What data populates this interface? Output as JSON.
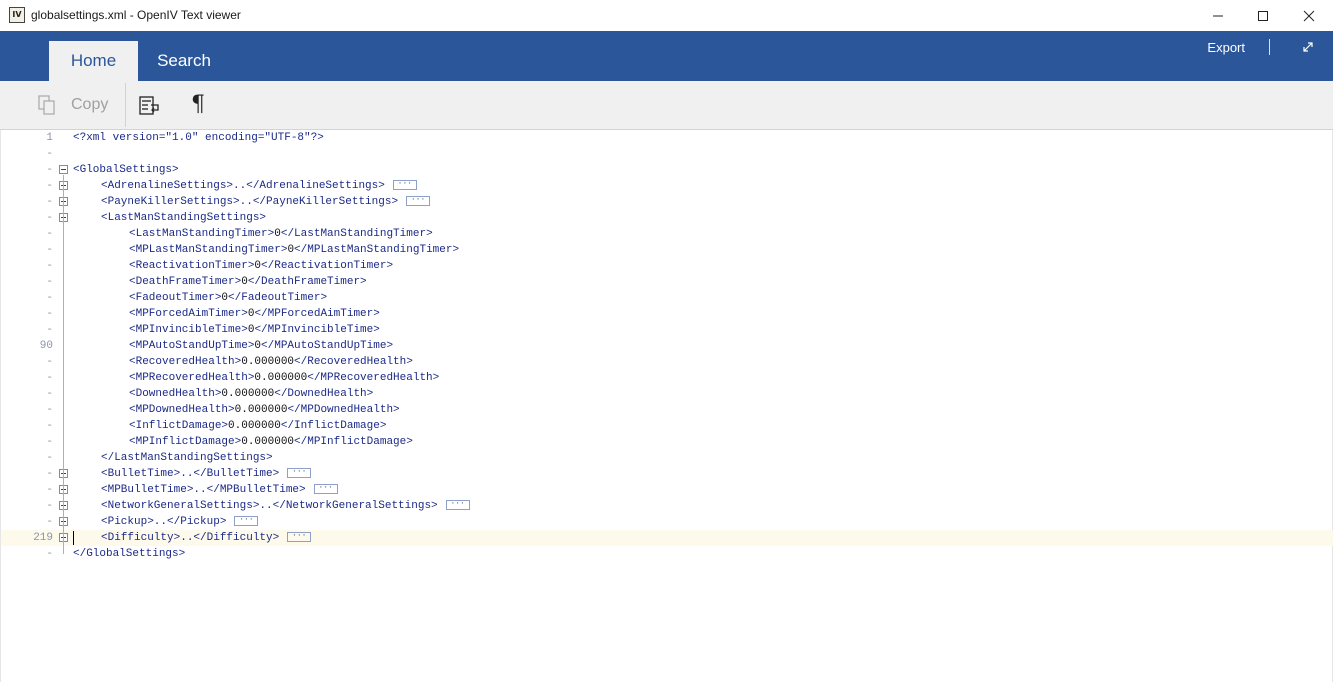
{
  "window": {
    "title": "globalsettings.xml - OpenIV Text viewer",
    "app_icon_text": "IV"
  },
  "ribbon": {
    "tabs": [
      "Home",
      "Search"
    ],
    "active_tab": "Home",
    "export_label": "Export"
  },
  "toolbar": {
    "copy_label": "Copy",
    "pilcrow": "¶"
  },
  "editor": {
    "collapsed_marker": "···",
    "lines": [
      {
        "num": "1",
        "indent": 0,
        "fold": "",
        "segs": [
          {
            "t": "<?xml version=\"1.0\" encoding=\"UTF-8\"?>",
            "c": "decl"
          }
        ]
      },
      {
        "num": "-",
        "indent": 0,
        "fold": "",
        "segs": []
      },
      {
        "num": "-",
        "indent": 0,
        "fold": "minus",
        "segs": [
          {
            "t": "<GlobalSettings>",
            "c": "tag"
          }
        ]
      },
      {
        "num": "-",
        "indent": 1,
        "fold": "plus",
        "segs": [
          {
            "t": "<AdrenalineSettings>..</AdrenalineSettings>",
            "c": "tag"
          }
        ],
        "more": true
      },
      {
        "num": "-",
        "indent": 1,
        "fold": "plus",
        "segs": [
          {
            "t": "<PayneKillerSettings>..</PayneKillerSettings>",
            "c": "tag"
          }
        ],
        "more": true
      },
      {
        "num": "-",
        "indent": 1,
        "fold": "minus",
        "segs": [
          {
            "t": "<LastManStandingSettings>",
            "c": "tag"
          }
        ]
      },
      {
        "num": "-",
        "indent": 2,
        "fold": "",
        "segs": [
          {
            "t": "<LastManStandingTimer>",
            "c": "tag"
          },
          {
            "t": "0",
            "c": "val"
          },
          {
            "t": "</LastManStandingTimer>",
            "c": "tag"
          }
        ]
      },
      {
        "num": "-",
        "indent": 2,
        "fold": "",
        "segs": [
          {
            "t": "<MPLastManStandingTimer>",
            "c": "tag"
          },
          {
            "t": "0",
            "c": "val"
          },
          {
            "t": "</MPLastManStandingTimer>",
            "c": "tag"
          }
        ]
      },
      {
        "num": "-",
        "indent": 2,
        "fold": "",
        "segs": [
          {
            "t": "<ReactivationTimer>",
            "c": "tag"
          },
          {
            "t": "0",
            "c": "val"
          },
          {
            "t": "</ReactivationTimer>",
            "c": "tag"
          }
        ]
      },
      {
        "num": "-",
        "indent": 2,
        "fold": "",
        "segs": [
          {
            "t": "<DeathFrameTimer>",
            "c": "tag"
          },
          {
            "t": "0",
            "c": "val"
          },
          {
            "t": "</DeathFrameTimer>",
            "c": "tag"
          }
        ]
      },
      {
        "num": "-",
        "indent": 2,
        "fold": "",
        "segs": [
          {
            "t": "<FadeoutTimer>",
            "c": "tag"
          },
          {
            "t": "0",
            "c": "val"
          },
          {
            "t": "</FadeoutTimer>",
            "c": "tag"
          }
        ]
      },
      {
        "num": "-",
        "indent": 2,
        "fold": "",
        "segs": [
          {
            "t": "<MPForcedAimTimer>",
            "c": "tag"
          },
          {
            "t": "0",
            "c": "val"
          },
          {
            "t": "</MPForcedAimTimer>",
            "c": "tag"
          }
        ]
      },
      {
        "num": "-",
        "indent": 2,
        "fold": "",
        "segs": [
          {
            "t": "<MPInvincibleTime>",
            "c": "tag"
          },
          {
            "t": "0",
            "c": "val"
          },
          {
            "t": "</MPInvincibleTime>",
            "c": "tag"
          }
        ]
      },
      {
        "num": "90",
        "indent": 2,
        "fold": "",
        "segs": [
          {
            "t": "<MPAutoStandUpTime>",
            "c": "tag"
          },
          {
            "t": "0",
            "c": "val"
          },
          {
            "t": "</MPAutoStandUpTime>",
            "c": "tag"
          }
        ]
      },
      {
        "num": "-",
        "indent": 2,
        "fold": "",
        "segs": [
          {
            "t": "<RecoveredHealth>",
            "c": "tag"
          },
          {
            "t": "0.000000",
            "c": "val"
          },
          {
            "t": "</RecoveredHealth>",
            "c": "tag"
          }
        ]
      },
      {
        "num": "-",
        "indent": 2,
        "fold": "",
        "segs": [
          {
            "t": "<MPRecoveredHealth>",
            "c": "tag"
          },
          {
            "t": "0.000000",
            "c": "val"
          },
          {
            "t": "</MPRecoveredHealth>",
            "c": "tag"
          }
        ]
      },
      {
        "num": "-",
        "indent": 2,
        "fold": "",
        "segs": [
          {
            "t": "<DownedHealth>",
            "c": "tag"
          },
          {
            "t": "0.000000",
            "c": "val"
          },
          {
            "t": "</DownedHealth>",
            "c": "tag"
          }
        ]
      },
      {
        "num": "-",
        "indent": 2,
        "fold": "",
        "segs": [
          {
            "t": "<MPDownedHealth>",
            "c": "tag"
          },
          {
            "t": "0.000000",
            "c": "val"
          },
          {
            "t": "</MPDownedHealth>",
            "c": "tag"
          }
        ]
      },
      {
        "num": "-",
        "indent": 2,
        "fold": "",
        "segs": [
          {
            "t": "<InflictDamage>",
            "c": "tag"
          },
          {
            "t": "0.000000",
            "c": "val"
          },
          {
            "t": "</InflictDamage>",
            "c": "tag"
          }
        ]
      },
      {
        "num": "-",
        "indent": 2,
        "fold": "",
        "segs": [
          {
            "t": "<MPInflictDamage>",
            "c": "tag"
          },
          {
            "t": "0.000000",
            "c": "val"
          },
          {
            "t": "</MPInflictDamage>",
            "c": "tag"
          }
        ]
      },
      {
        "num": "-",
        "indent": 1,
        "fold": "",
        "segs": [
          {
            "t": "</LastManStandingSettings>",
            "c": "tag"
          }
        ]
      },
      {
        "num": "-",
        "indent": 1,
        "fold": "plus",
        "segs": [
          {
            "t": "<BulletTime>..</BulletTime>",
            "c": "tag"
          }
        ],
        "more": true
      },
      {
        "num": "-",
        "indent": 1,
        "fold": "plus",
        "segs": [
          {
            "t": "<MPBulletTime>..</MPBulletTime>",
            "c": "tag"
          }
        ],
        "more": true
      },
      {
        "num": "-",
        "indent": 1,
        "fold": "plus",
        "segs": [
          {
            "t": "<NetworkGeneralSettings>..</NetworkGeneralSettings>",
            "c": "tag"
          }
        ],
        "more": true
      },
      {
        "num": "-",
        "indent": 1,
        "fold": "plus",
        "segs": [
          {
            "t": "<Pickup>..</Pickup>",
            "c": "tag"
          }
        ],
        "more": true
      },
      {
        "num": "219",
        "indent": 1,
        "fold": "plus",
        "segs": [
          {
            "t": "<Difficulty>..</Difficulty>",
            "c": "tag"
          }
        ],
        "more": true,
        "current": true
      },
      {
        "num": "-",
        "indent": 0,
        "fold": "",
        "segs": [
          {
            "t": "</GlobalSettings>",
            "c": "tag"
          }
        ]
      }
    ]
  }
}
